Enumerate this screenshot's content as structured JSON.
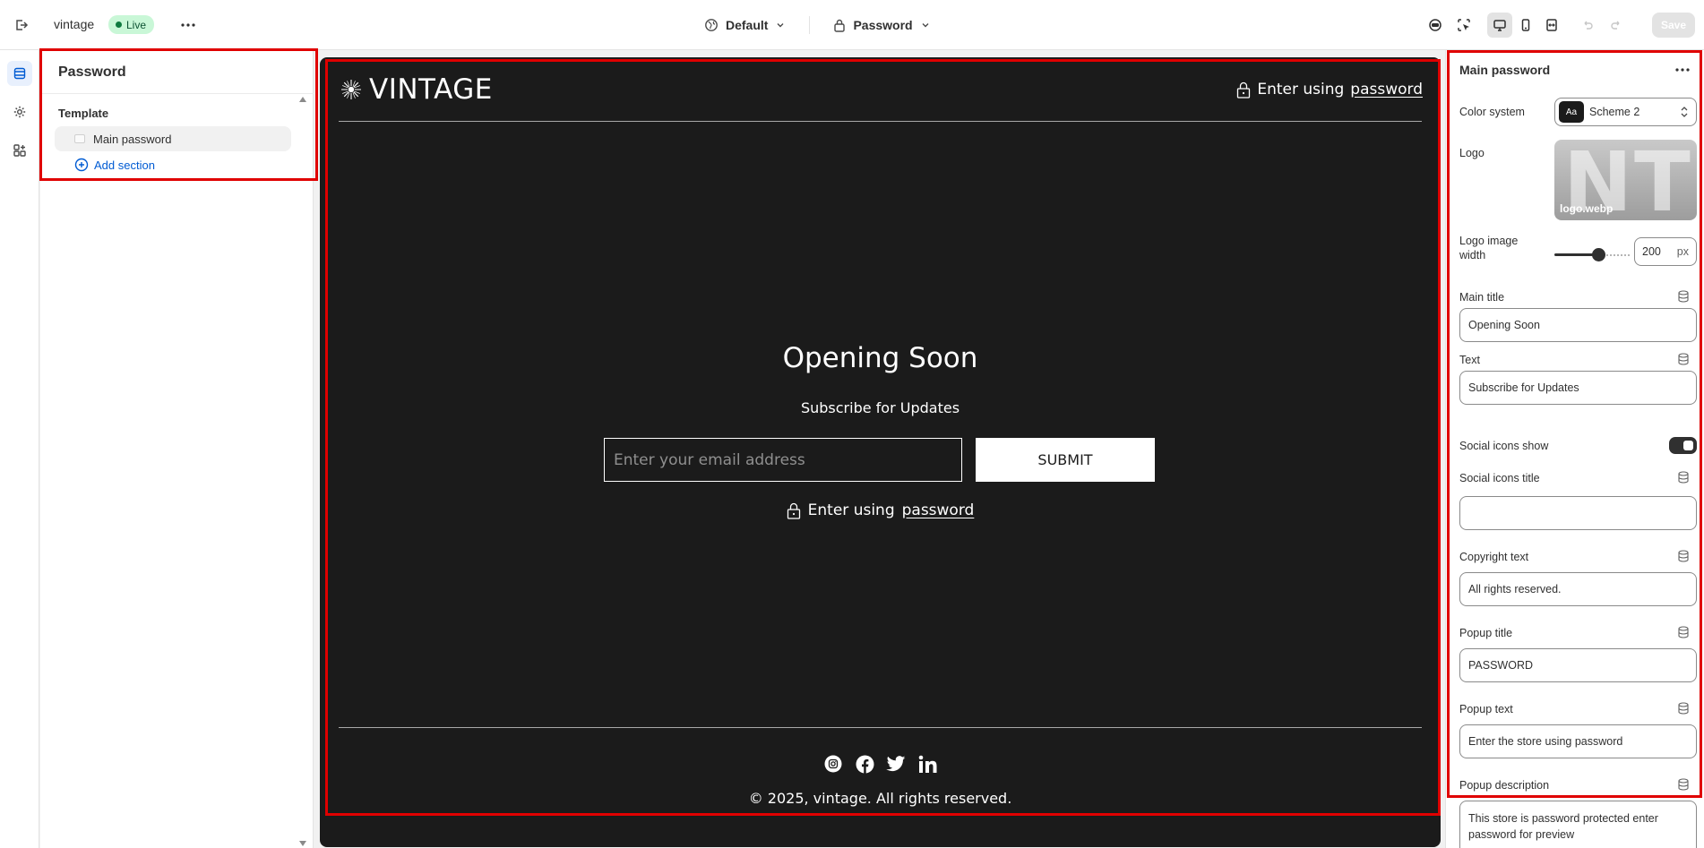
{
  "topbar": {
    "store_name": "vintage",
    "live_badge": "Live",
    "theme_select": "Default",
    "page_select": "Password",
    "save_label": "Save"
  },
  "left_panel": {
    "title": "Password",
    "group_label": "Template",
    "section_item": "Main password",
    "add_section": "Add section"
  },
  "preview": {
    "brand": "VINTAGE",
    "enter_prefix": "Enter using",
    "enter_link": "password",
    "title": "Opening Soon",
    "subtitle": "Subscribe for Updates",
    "email_placeholder": "Enter your email address",
    "submit_label": "SUBMIT",
    "copyright": "© 2025, vintage. All rights reserved.",
    "social_icons": [
      "instagram-icon",
      "facebook-icon",
      "twitter-icon",
      "linkedin-icon"
    ]
  },
  "right_panel": {
    "title": "Main password",
    "color_system_label": "Color system",
    "color_system_value": "Scheme 2",
    "color_swatch_text": "Aa",
    "logo_label": "Logo",
    "logo_ghost": "NT",
    "logo_filename": "logo.webp",
    "logo_width_label_1": "Logo image",
    "logo_width_label_2": "width",
    "logo_width_value": "200",
    "logo_width_unit": "px",
    "logo_width_fraction": 0.6,
    "main_title_label": "Main title",
    "main_title_value": "Opening Soon",
    "text_label": "Text",
    "text_value": "Subscribe for Updates",
    "social_show_label": "Social icons show",
    "social_show_on": true,
    "social_title_label": "Social icons title",
    "social_title_value": "",
    "copyright_label": "Copyright text",
    "copyright_value": "All rights reserved.",
    "popup_title_label": "Popup title",
    "popup_title_value": "PASSWORD",
    "popup_text_label": "Popup text",
    "popup_text_value": "Enter the store using password",
    "popup_desc_label": "Popup description",
    "popup_desc_value": "This store is password protected enter password for preview"
  },
  "colors": {
    "highlight": "#e00000",
    "preview_bg": "#1b1b1b",
    "link_blue": "#005bd3",
    "live_green": "#c9f7d7"
  }
}
